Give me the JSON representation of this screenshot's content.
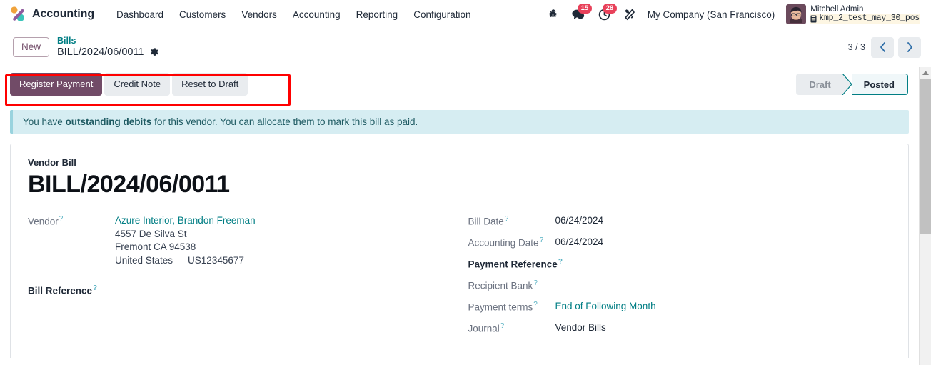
{
  "navbar": {
    "brand": "Accounting",
    "menu": [
      {
        "label": "Dashboard"
      },
      {
        "label": "Customers"
      },
      {
        "label": "Vendors"
      },
      {
        "label": "Accounting"
      },
      {
        "label": "Reporting"
      },
      {
        "label": "Configuration"
      }
    ],
    "icons": {
      "bug": "bug-icon",
      "chat": "chat-icon",
      "activity": "clock-icon",
      "tools": "wrench-icon"
    },
    "chat_count": "15",
    "activity_count": "28",
    "company": "My Company (San Francisco)",
    "user_name": "Mitchell Admin",
    "database": "kmp_2_test_may_30_pos"
  },
  "control_panel": {
    "new_label": "New",
    "breadcrumb_parent": "Bills",
    "breadcrumb_current": "BILL/2024/06/0011",
    "pager_count": "3 / 3"
  },
  "action_bar": {
    "buttons": [
      {
        "label": "Register Payment",
        "style": "primary"
      },
      {
        "label": "Credit Note",
        "style": "secondary"
      },
      {
        "label": "Reset to Draft",
        "style": "secondary"
      }
    ],
    "status": [
      {
        "label": "Draft",
        "active": false
      },
      {
        "label": "Posted",
        "active": true
      }
    ]
  },
  "alert": {
    "prefix": "You have ",
    "bold": "outstanding debits",
    "suffix": " for this vendor. You can allocate them to mark this bill as paid."
  },
  "form": {
    "sub_label": "Vendor Bill",
    "title": "BILL/2024/06/0011",
    "left": {
      "vendor_label": "Vendor",
      "vendor_name": "Azure Interior, Brandon Freeman",
      "vendor_street": "4557 De Silva St",
      "vendor_city": "Fremont CA 94538",
      "vendor_country": "United States — US12345677",
      "bill_reference_label": "Bill Reference",
      "bill_reference_value": ""
    },
    "right": [
      {
        "label": "Bill Date",
        "value": "06/24/2024",
        "required": false,
        "link": false
      },
      {
        "label": "Accounting Date",
        "value": "06/24/2024",
        "required": false,
        "link": false
      },
      {
        "label": "Payment Reference",
        "value": "",
        "required": true,
        "link": false
      },
      {
        "label": "Recipient Bank",
        "value": "",
        "required": false,
        "link": false
      },
      {
        "label": "Payment terms",
        "value": "End of Following Month",
        "required": false,
        "link": true
      },
      {
        "label": "Journal",
        "value": "Vendor Bills",
        "required": false,
        "link": false
      }
    ]
  },
  "colors": {
    "primary": "#714b67",
    "accent": "#017e84",
    "badge": "#e8415a",
    "alert_bg": "#d6edf2",
    "highlight": "#ff0000"
  }
}
